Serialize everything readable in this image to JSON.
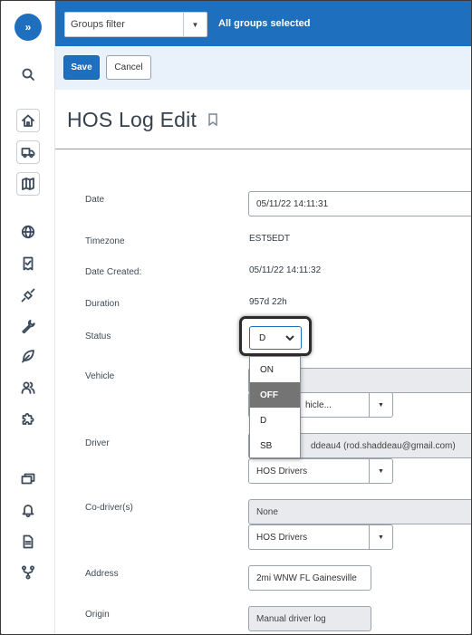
{
  "topbar": {
    "groups_filter_placeholder": "Groups filter",
    "groups_selected_label": "All groups selected",
    "color": "#1f6fbf"
  },
  "actions": {
    "save_label": "Save",
    "cancel_label": "Cancel"
  },
  "page": {
    "title": "HOS Log Edit"
  },
  "sidebar": {
    "expand_glyph": "»",
    "icons": [
      "search-icon",
      "home-icon",
      "truck-icon",
      "map-icon",
      "globe-icon",
      "checklist-icon",
      "connector-icon",
      "wrench-icon",
      "leaf-icon",
      "users-icon",
      "puzzle-icon",
      "messages-icon",
      "bell-icon",
      "document-icon",
      "workflow-icon"
    ]
  },
  "form": {
    "date": {
      "label": "Date",
      "value": "05/11/22 14:11:31"
    },
    "timezone": {
      "label": "Timezone",
      "value": "EST5EDT"
    },
    "date_created": {
      "label": "Date Created:",
      "value": "05/11/22 14:11:32"
    },
    "duration": {
      "label": "Duration",
      "value": "957d 22h"
    },
    "status": {
      "label": "Status",
      "value": "D",
      "options": [
        "ON",
        "OFF",
        "D",
        "SB"
      ],
      "highlighted": "OFF"
    },
    "vehicle": {
      "label": "Vehicle",
      "select_value": "hicle..."
    },
    "driver": {
      "label": "Driver",
      "value": "ddeau4 (rod.shaddeau@gmail.com)",
      "group_select": "HOS Drivers"
    },
    "codriver": {
      "label": "Co-driver(s)",
      "value": "None",
      "group_select": "HOS Drivers"
    },
    "address": {
      "label": "Address",
      "value": "2mi WNW FL Gainesville"
    },
    "origin": {
      "label": "Origin",
      "value": "Manual driver log"
    }
  }
}
